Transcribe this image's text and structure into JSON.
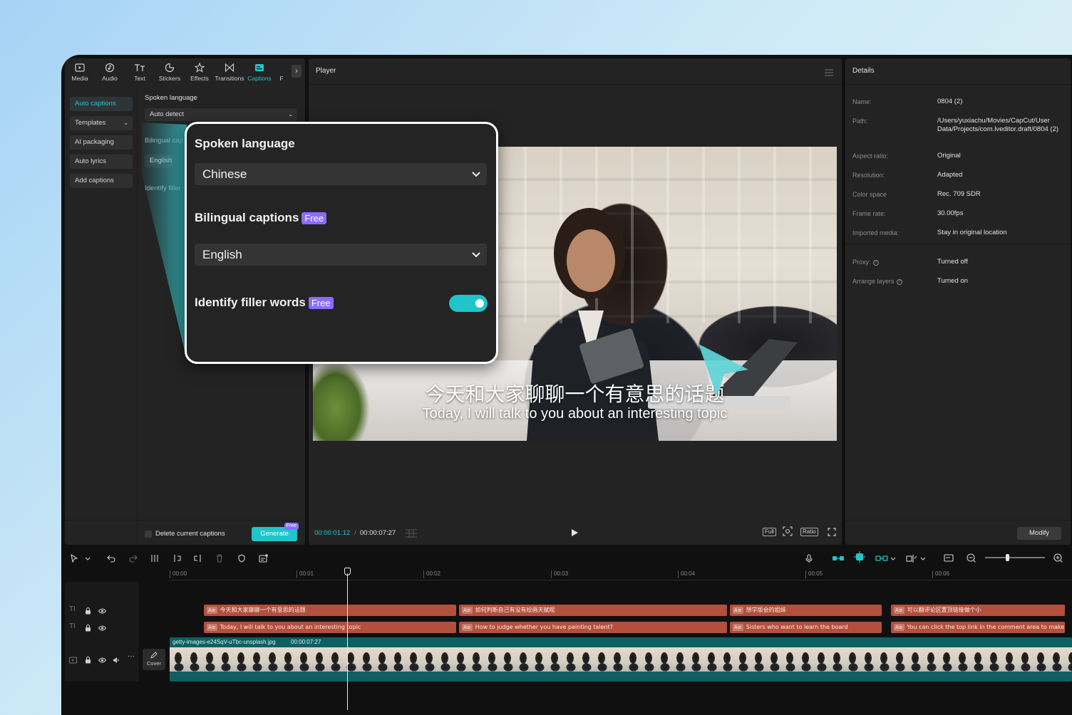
{
  "tabs": [
    {
      "label": "Media",
      "icon": "media-icon",
      "active": false
    },
    {
      "label": "Audio",
      "icon": "audio-icon",
      "active": false
    },
    {
      "label": "Text",
      "icon": "text-icon",
      "active": false
    },
    {
      "label": "Stickers",
      "icon": "stickers-icon",
      "active": false
    },
    {
      "label": "Effects",
      "icon": "effects-icon",
      "active": false
    },
    {
      "label": "Transitions",
      "icon": "transitions-icon",
      "active": false
    },
    {
      "label": "Captions",
      "icon": "captions-icon",
      "active": true
    },
    {
      "label": "F",
      "icon": "filters-icon",
      "active": false
    }
  ],
  "sidenav": {
    "items": [
      {
        "label": "Auto captions",
        "active": true
      },
      {
        "label": "Templates"
      },
      {
        "label": "AI packaging"
      },
      {
        "label": "Auto lyrics"
      },
      {
        "label": "Add captions"
      }
    ]
  },
  "left_panel": {
    "spoken_language_label": "Spoken language",
    "spoken_language_value": "Auto detect",
    "bilingual_label": "Bilingual cap",
    "bilingual_value": "English",
    "filler_label": "Identify filler",
    "delete_label": "Delete current captions",
    "generate_label": "Generate",
    "generate_badge": "Free"
  },
  "callout": {
    "spoken_language_label": "Spoken language",
    "spoken_language_value": "Chinese",
    "bilingual_label": "Bilingual captions",
    "bilingual_badge": "Free",
    "bilingual_value": "English",
    "filler_label": "Identify filler words",
    "filler_badge": "Free",
    "filler_enabled": true
  },
  "player": {
    "title": "Player",
    "subtitle_cn": "今天和大家聊聊一个有意思的话题",
    "subtitle_en": "Today, I will talk to you about an interesting topic",
    "time_current": "00:00:01:12",
    "time_separator": "/",
    "time_total": "00:00:07:27",
    "btn_full": "Full",
    "btn_ratio": "Ratio"
  },
  "details": {
    "title": "Details",
    "rows": [
      {
        "label": "Name:",
        "value": "0804 (2)"
      },
      {
        "label": "Path:",
        "value": "/Users/yuxiachu/Movies/CapCut/User Data/Projects/com.lveditor.draft/0804 (2)"
      },
      {
        "label": "Aspect ratio:",
        "value": "Original"
      },
      {
        "label": "Resolution:",
        "value": "Adapted"
      },
      {
        "label": "Color space",
        "value": "Rec. 709 SDR"
      },
      {
        "label": "Frame rate:",
        "value": "30.00fps"
      },
      {
        "label": "Imported media:",
        "value": "Stay in original location"
      },
      {
        "label": "Proxy:",
        "value": "Turned off"
      },
      {
        "label": "Arrange layers",
        "value": "Turned on"
      }
    ],
    "modify_label": "Modify"
  },
  "timeline": {
    "ruler": [
      "00:00",
      "00:01",
      "00:02",
      "00:03",
      "00:04",
      "00:05",
      "00:06"
    ],
    "captions_cn": [
      "今天和大家聊聊一个有意思的话题",
      "如何判断自己有没有绘画天赋呢",
      "想学版会的姐妹",
      "可以翻评论区置顶链接做个小"
    ],
    "captions_en": [
      "Today, I will talk to you about an interesting topic",
      "How to judge whether you have painting talent?",
      "Sisters who want to learn the board",
      "You can click the top link in the comment area to make a s"
    ],
    "video_name": "getty-images-e24SqV-uTbc-unsplash.jpg",
    "video_duration": "00:00:07:27",
    "cover_label": "Cover",
    "playhead_progress": 0.18
  },
  "colors": {
    "accent": "#1fc5c9",
    "badge": "#8a6cff",
    "caption_clip": "#b34f3d",
    "video_clip": "#0f5f62"
  }
}
